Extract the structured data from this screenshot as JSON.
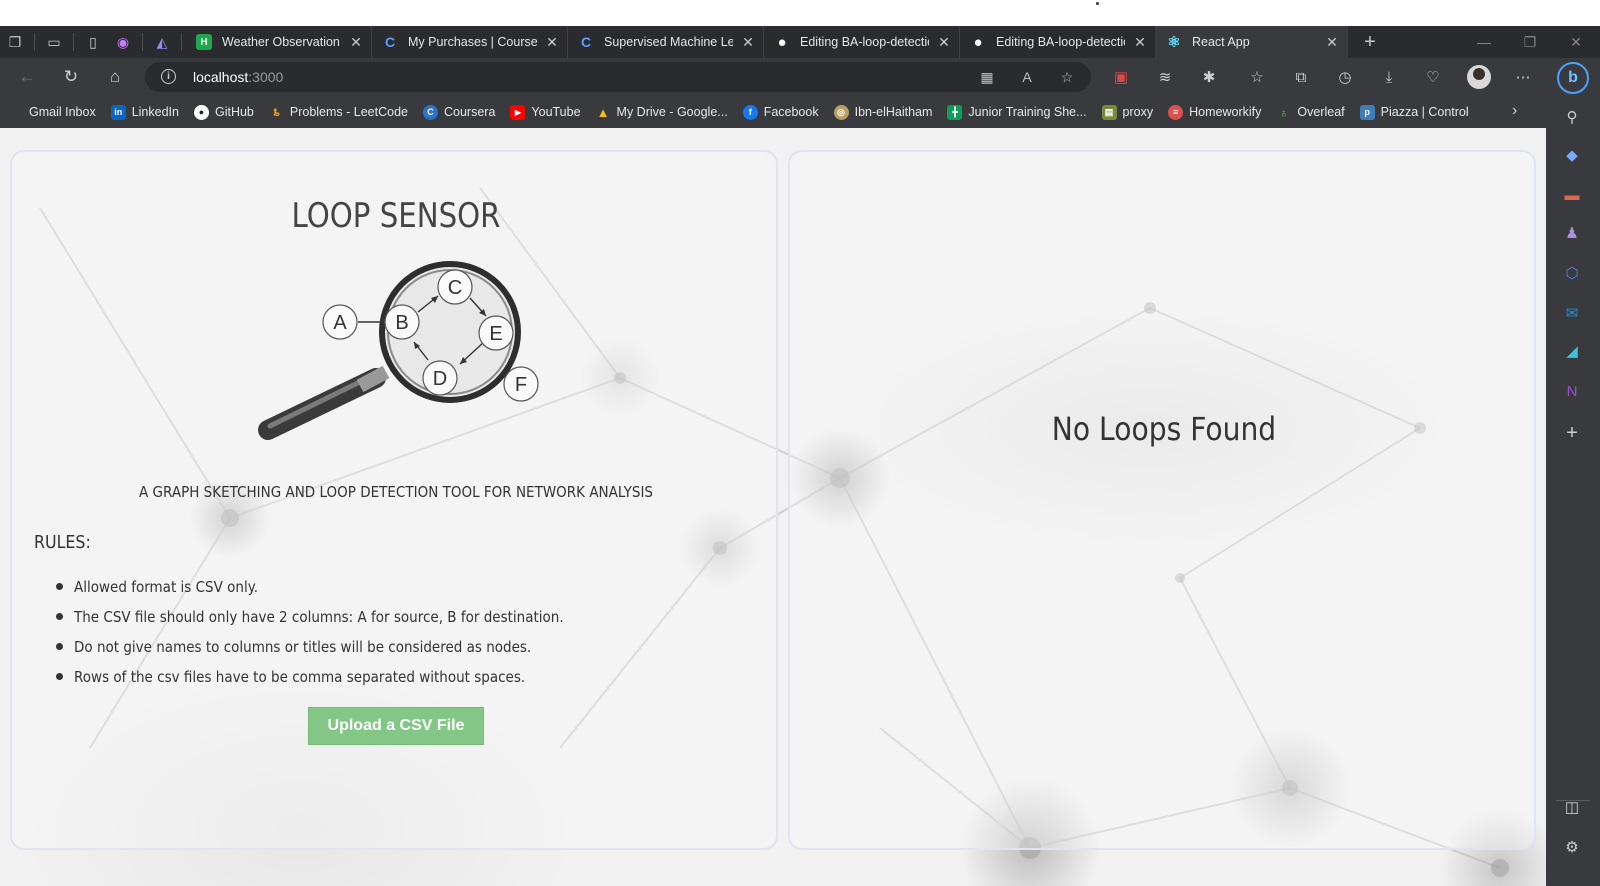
{
  "tabs": [
    {
      "title": "Weather Observation Sta",
      "favicon": "hackerrank-icon",
      "color": "#1ba94c",
      "glyph": "H"
    },
    {
      "title": "My Purchases | Coursera",
      "favicon": "coursera-icon",
      "color": "#2a73cc",
      "glyph": "C"
    },
    {
      "title": "Supervised Machine Lear",
      "favicon": "coursera-icon",
      "color": "#2a73cc",
      "glyph": "C"
    },
    {
      "title": "Editing BA-loop-detectio",
      "favicon": "github-icon",
      "color": "#ffffff",
      "glyph": "●"
    },
    {
      "title": "Editing BA-loop-detectio",
      "favicon": "github-icon",
      "color": "#ffffff",
      "glyph": "●"
    },
    {
      "title": "React App",
      "favicon": "react-icon",
      "color": "#61dafb",
      "glyph": "⚛",
      "active": true
    }
  ],
  "address": {
    "host": "localhost",
    "port": ":3000"
  },
  "bookmarks": [
    {
      "label": "Gmail Inbox",
      "icon": "gmail-icon"
    },
    {
      "label": "LinkedIn",
      "icon": "linkedin-icon"
    },
    {
      "label": "GitHub",
      "icon": "github-icon"
    },
    {
      "label": "Problems - LeetCode",
      "icon": "leetcode-icon"
    },
    {
      "label": "Coursera",
      "icon": "coursera-icon"
    },
    {
      "label": "YouTube",
      "icon": "youtube-icon"
    },
    {
      "label": "My Drive - Google...",
      "icon": "google-drive-icon"
    },
    {
      "label": "Facebook",
      "icon": "facebook-icon"
    },
    {
      "label": "Ibn-elHaitham",
      "icon": "ibn-elhaitham-icon"
    },
    {
      "label": "Junior Training She...",
      "icon": "google-sheets-icon"
    },
    {
      "label": "proxy",
      "icon": "proxy-icon"
    },
    {
      "label": "Homeworkify",
      "icon": "homeworkify-icon"
    },
    {
      "label": "Overleaf",
      "icon": "overleaf-icon"
    },
    {
      "label": "Piazza | Control",
      "icon": "piazza-icon"
    }
  ],
  "app": {
    "title": "LOOP SENSOR",
    "subtitle": "A GRAPH SKETCHING AND LOOP DETECTION TOOL FOR NETWORK ANALYSIS",
    "rules_heading": "RULES:",
    "rules": [
      "Allowed format is CSV only.",
      "The CSV file should only have 2 columns: A for source, B for destination.",
      "Do not give names to columns or titles will be considered as nodes.",
      "Rows of the csv files have to be comma separated without spaces."
    ],
    "upload_label": "Upload a CSV File",
    "result_text": "No Loops Found",
    "logo_nodes": [
      "A",
      "B",
      "C",
      "D",
      "E",
      "F"
    ]
  },
  "colors": {
    "upload_button": "#82c786",
    "chrome_dark": "#2a2b2e",
    "chrome_mid": "#393a3e",
    "panel_border": "#e0e4ee"
  }
}
